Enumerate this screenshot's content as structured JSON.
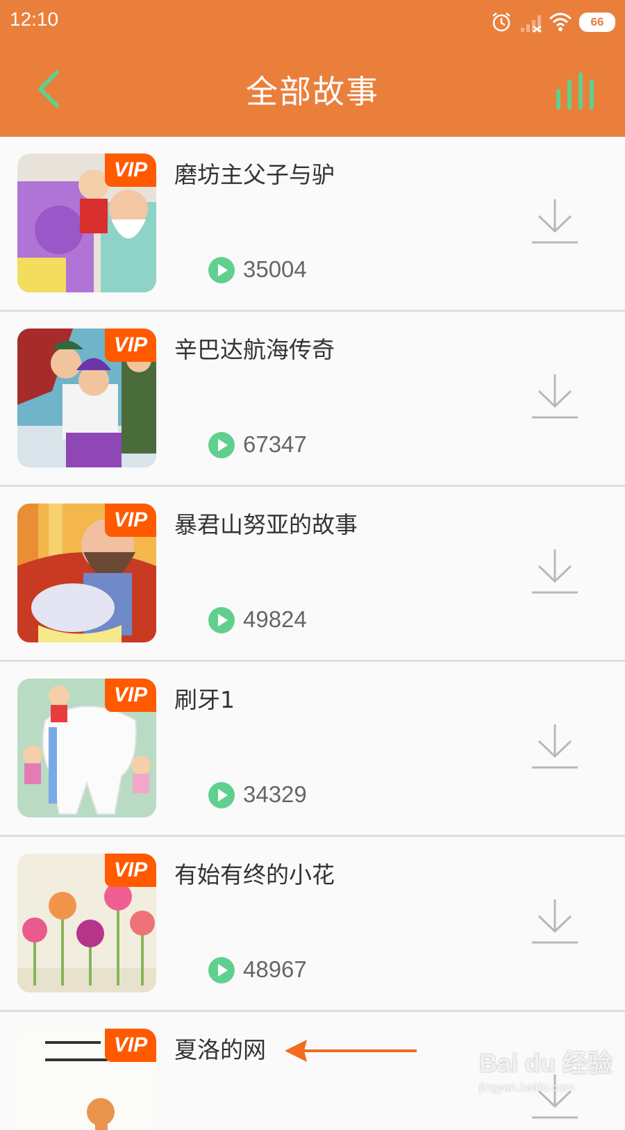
{
  "status_bar": {
    "time": "12:10",
    "battery": "66"
  },
  "header": {
    "title": "全部故事"
  },
  "colors": {
    "header": "#ea7f3c",
    "vip": "#ff5a00",
    "play": "#5fd08e",
    "back": "#5fd08e"
  },
  "stories": [
    {
      "title": "磨坊主父子与驴",
      "vip": "VIP",
      "plays": "35004"
    },
    {
      "title": "辛巴达航海传奇",
      "vip": "VIP",
      "plays": "67347"
    },
    {
      "title": "暴君山努亚的故事",
      "vip": "VIP",
      "plays": "49824"
    },
    {
      "title": "刷牙1",
      "vip": "VIP",
      "plays": "34329"
    },
    {
      "title": "有始有终的小花",
      "vip": "VIP",
      "plays": "48967"
    },
    {
      "title": "夏洛的网",
      "vip": "VIP",
      "plays": ""
    }
  ],
  "watermark": {
    "brand": "Bai du 经验",
    "site": "jingyan.baidu.com"
  }
}
